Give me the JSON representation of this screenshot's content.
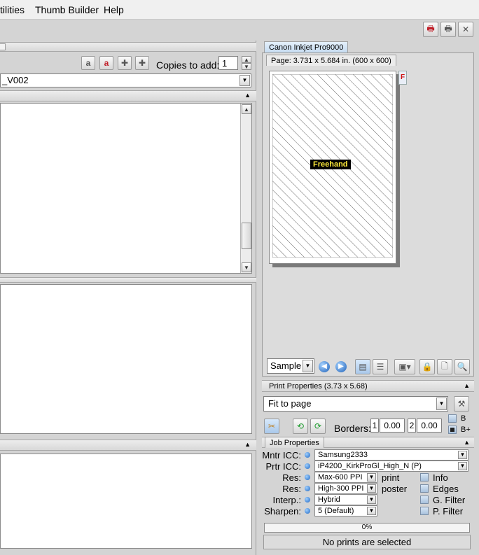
{
  "menu": {
    "utilities": "tilities",
    "thumb_builder": "Thumb Builder",
    "help": "Help"
  },
  "left": {
    "copies_label": "Copies to add:",
    "copies_value": "1",
    "folder_combo": "_V002"
  },
  "printer": {
    "tab_label": "Canon Inkjet Pro9000",
    "page_info": "Page: 3.731 x 5.684 in.  (600 x 600)",
    "f_badge": "F",
    "freehand_label": "Freehand",
    "sample_combo": "Sample"
  },
  "print_properties": {
    "tab_label": "Print Properties (3.73 x 5.68)",
    "fit_combo": "Fit to page",
    "borders_label": "Borders:",
    "border1_index": "1",
    "border1_value": "0.00",
    "border2_index": "2",
    "border2_value": "0.00",
    "b_label": "B",
    "bplus_label": "B+"
  },
  "job_properties": {
    "tab_label": "Job Properties",
    "mntr_label": "Mntr ICC:",
    "mntr_value": "Samsung2333",
    "prtr_label": "Prtr ICC:",
    "prtr_value": "iP4200_KirkProGl_High_N (P)",
    "res1_label": "Res:",
    "res1_value": "Max-600 PPI",
    "res1_suffix": "print",
    "res2_label": "Res:",
    "res2_value": "High-300 PPI",
    "res2_suffix": "poster",
    "interp_label": "Interp.:",
    "interp_value": "Hybrid",
    "sharpen_label": "Sharpen:",
    "sharpen_value": "5 (Default)",
    "info_label": "Info",
    "edges_label": "Edges",
    "gfilter_label": "G. Filter",
    "pfilter_label": "P. Filter"
  },
  "progress": {
    "percent_text": "0%",
    "fraction": 0
  },
  "status": {
    "message": "No prints are selected"
  }
}
